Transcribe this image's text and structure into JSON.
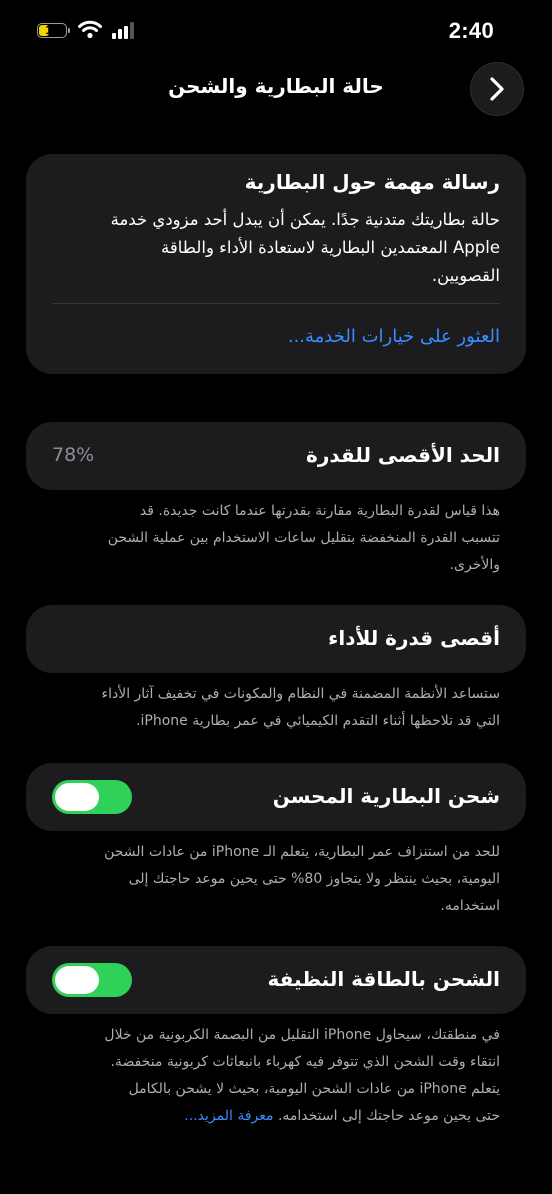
{
  "status_bar": {
    "time": "2:40",
    "battery_level": "19"
  },
  "header": {
    "title": "حالة البطارية والشحن"
  },
  "important_message": {
    "title": "رسالة مهمة حول البطارية",
    "body_lines": [
      "حالة بطاريتك متدنية جدًا. يمكن أن يبدل أحد مزودي خدمة",
      "Apple المعتمدين البطارية لاستعادة الأداء والطاقة",
      "القصويين."
    ],
    "link": "العثور على خيارات الخدمة..."
  },
  "max_capacity": {
    "label": "الحد الأقصى للقدرة",
    "value": "78%",
    "footnote_lines": [
      "هذا قياس لقدرة البطارية مقارنة بقدرتها عندما كانت جديدة. قد",
      "تتسبب القدرة المنخفضة بتقليل ساعات الاستخدام بين عملية الشحن",
      "والأخرى."
    ]
  },
  "peak_performance": {
    "label": "أقصى قدرة للأداء",
    "footnote_lines": [
      "ستساعد الأنظمة المضمنة في النظام والمكونات في تخفيف آثار الأداء",
      "التي قد تلاحظها أثناء التقدم الكيميائي في عمر بطارية iPhone."
    ]
  },
  "optimized_charging": {
    "label": "شحن البطارية المحسن",
    "enabled": true,
    "footnote_lines": [
      "للحد من استنزاف عمر البطارية، يتعلم الـ iPhone من عادات الشحن",
      "اليومية، بحيث ينتظر ولا يتجاوز 80% حتى يحين موعد حاجتك إلى",
      "استخدامه."
    ]
  },
  "clean_energy": {
    "label": "الشحن بالطاقة النظيفة",
    "enabled": true,
    "footnote_lines": [
      "في منطقتك، سيحاول iPhone التقليل من البصمة الكربونية من خلال",
      "انتقاء وقت الشحن الذي تتوفر فيه كهرباء بانبعاثات كربونية منخفضة.",
      "يتعلم iPhone من عادات الشحن اليومية، بحيث لا يشحن بالكامل",
      "حتى يحين موعد حاجتك إلى استخدامه."
    ],
    "learn_more": "معرفة المزيد..."
  },
  "colors": {
    "background": "#000000",
    "card": "#1c1c1e",
    "link": "#3a8dff",
    "toggle_on": "#30d158",
    "battery_low": "#f5d400"
  },
  "icons": [
    "signal-bars-icon",
    "wifi-icon",
    "battery-icon",
    "chevron-right-icon"
  ]
}
